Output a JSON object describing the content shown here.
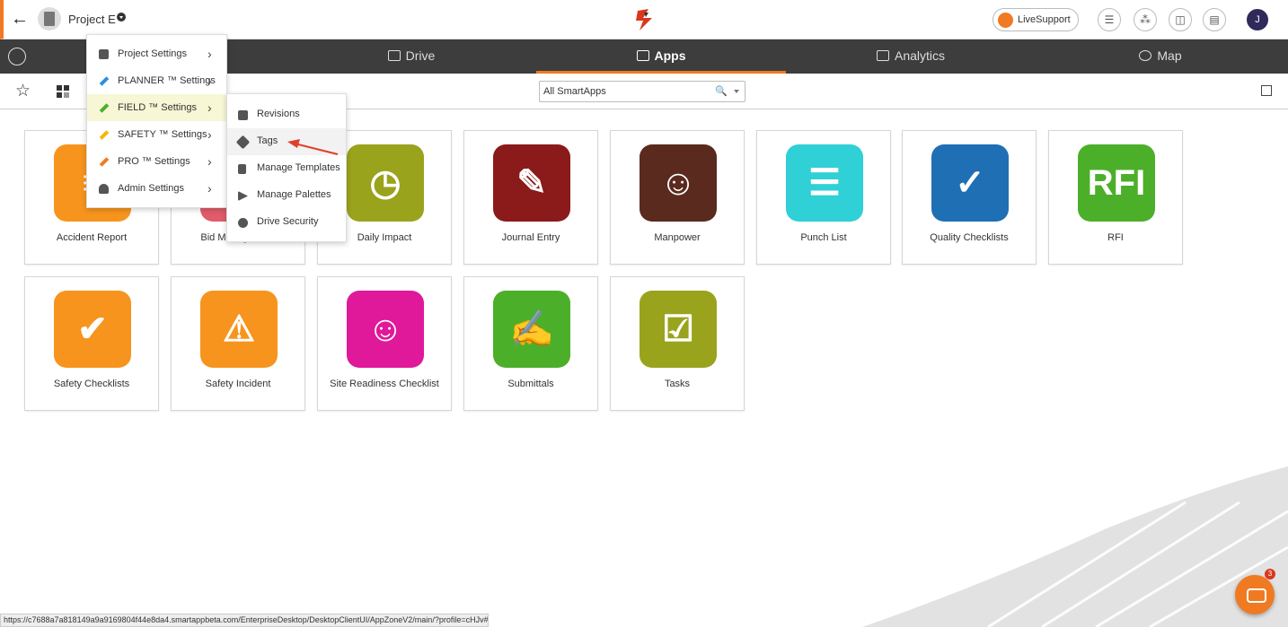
{
  "header": {
    "project_name": "Project E",
    "live_support": "LiveSupport",
    "avatar_initial": "J",
    "brand_color": "#f07a22"
  },
  "nav": {
    "tabs": [
      {
        "label": "Drive",
        "icon": "drive-icon"
      },
      {
        "label": "Apps",
        "icon": "apps-icon",
        "active": true
      },
      {
        "label": "Analytics",
        "icon": "analytics-icon"
      },
      {
        "label": "Map",
        "icon": "map-icon"
      }
    ]
  },
  "search": {
    "value": "All SmartApps"
  },
  "settings_menu": {
    "items": [
      {
        "label": "Project Settings",
        "icon": "camera-icon"
      },
      {
        "label": "PLANNER ™ Settings",
        "icon": "hammer-blue-icon"
      },
      {
        "label": "FIELD ™ Settings",
        "icon": "hammer-green-icon",
        "highlighted": true
      },
      {
        "label": "SAFETY ™ Settings",
        "icon": "hammer-yellow-icon"
      },
      {
        "label": "PRO ™ Settings",
        "icon": "hammer-orange-icon"
      },
      {
        "label": "Admin Settings",
        "icon": "admin-user-icon"
      }
    ]
  },
  "field_submenu": {
    "items": [
      {
        "label": "Revisions",
        "icon": "revisions-icon"
      },
      {
        "label": "Tags",
        "icon": "tag-icon",
        "highlighted": true
      },
      {
        "label": "Manage Templates",
        "icon": "template-icon"
      },
      {
        "label": "Manage Palettes",
        "icon": "palette-icon"
      },
      {
        "label": "Drive Security",
        "icon": "security-icon"
      }
    ]
  },
  "apps": [
    {
      "label": "Accident Report",
      "color": "#f7941d"
    },
    {
      "label": "Bid Management",
      "color": "#e05c6a"
    },
    {
      "label": "Daily Impact",
      "color": "#9aa31c"
    },
    {
      "label": "Journal Entry",
      "color": "#8b1a1a"
    },
    {
      "label": "Manpower",
      "color": "#5a2a1e"
    },
    {
      "label": "Punch List",
      "color": "#2fd0d6"
    },
    {
      "label": "Quality Checklists",
      "color": "#1f6fb5"
    },
    {
      "label": "RFI",
      "color": "#4caf2a",
      "badge_text": "RFI"
    },
    {
      "label": "Safety Checklists",
      "color": "#f7941d"
    },
    {
      "label": "Safety Incident",
      "color": "#f7941d"
    },
    {
      "label": "Site Readiness Checklist",
      "color": "#e0189a"
    },
    {
      "label": "Submittals",
      "color": "#4caf2a"
    },
    {
      "label": "Tasks",
      "color": "#9aa31c"
    }
  ],
  "status_url": "https://c7688a7a818149a9a9169804f44e8da4.smartappbeta.com/EnterpriseDesktop/DesktopClientUI/AppZoneV2/main/?profile=cHJv#",
  "chat_badge": "3"
}
